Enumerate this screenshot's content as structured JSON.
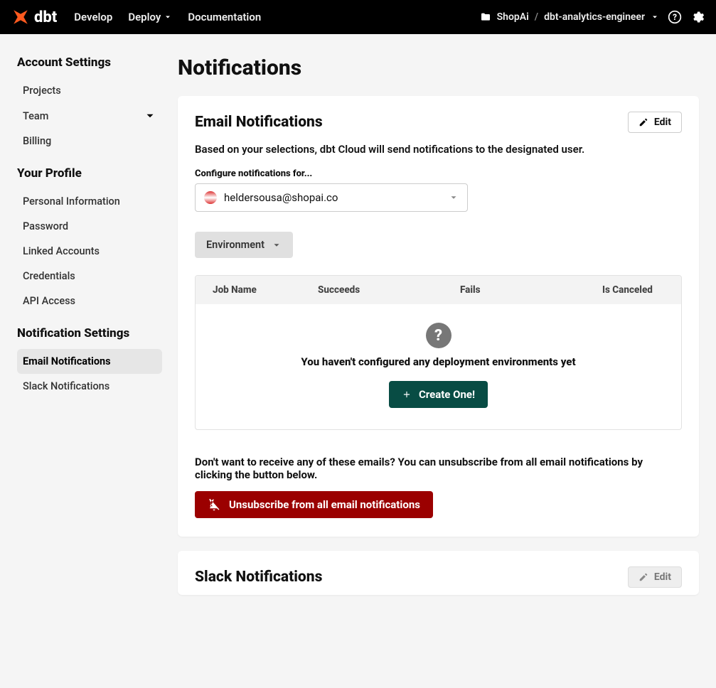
{
  "topbar": {
    "brand": "dbt",
    "nav": {
      "develop": "Develop",
      "deploy": "Deploy",
      "documentation": "Documentation"
    },
    "breadcrumb": {
      "account": "ShopAi",
      "project": "dbt-analytics-engineer"
    }
  },
  "sidebar": {
    "account_heading": "Account Settings",
    "account_items": {
      "projects": "Projects",
      "team": "Team",
      "billing": "Billing"
    },
    "profile_heading": "Your Profile",
    "profile_items": {
      "personal": "Personal Information",
      "password": "Password",
      "linked": "Linked Accounts",
      "credentials": "Credentials",
      "api": "API Access"
    },
    "notif_heading": "Notification Settings",
    "notif_items": {
      "email": "Email Notifications",
      "slack": "Slack Notifications"
    }
  },
  "page": {
    "title": "Notifications"
  },
  "email_card": {
    "title": "Email Notifications",
    "edit": "Edit",
    "description": "Based on your selections, dbt Cloud will send notifications to the designated user.",
    "configure_label": "Configure notifications for...",
    "user_email": "heldersousa@shopai.co",
    "env_button": "Environment",
    "table": {
      "job": "Job Name",
      "succeeds": "Succeeds",
      "fails": "Fails",
      "canceled": "Is Canceled"
    },
    "empty": {
      "message": "You haven't configured any deployment environments yet",
      "cta": "Create One!"
    },
    "unsub_text": "Don't want to receive any of these emails? You can unsubscribe from all email notifications by clicking the button below.",
    "unsub_button": "Unsubscribe from all email notifications"
  },
  "slack_card": {
    "title": "Slack Notifications",
    "edit": "Edit"
  }
}
